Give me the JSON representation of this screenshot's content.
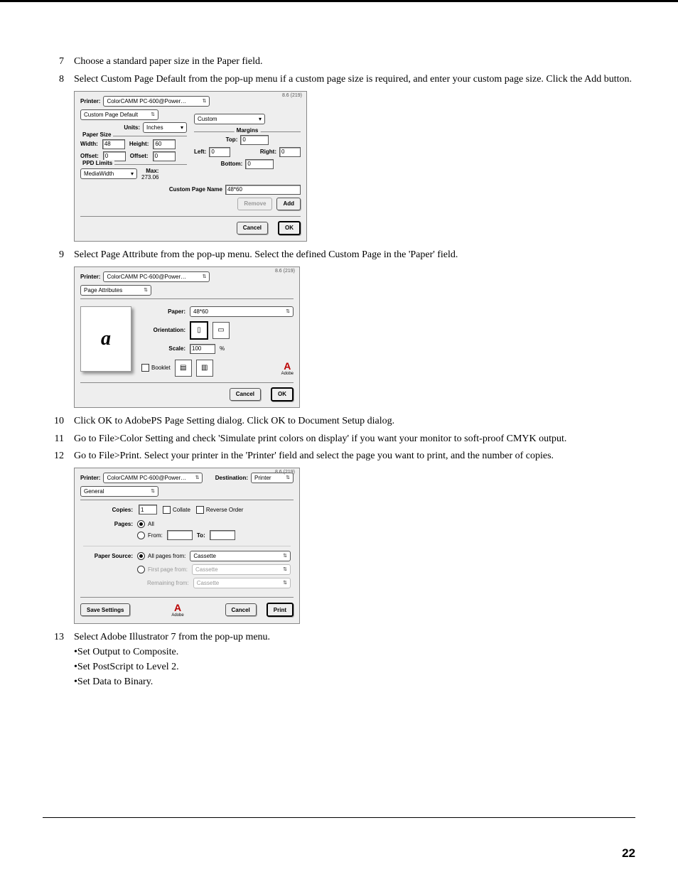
{
  "steps": {
    "s7": {
      "num": "7",
      "text": "Choose a standard paper size in the Paper field."
    },
    "s8": {
      "num": "8",
      "text": "Select Custom Page Default from the pop-up menu if a custom page size is required, and enter your custom page size. Click the Add button."
    },
    "s9": {
      "num": "9",
      "text": "Select Page Attribute from the pop-up menu. Select the defined Custom Page in the 'Paper' field."
    },
    "s10": {
      "num": "10",
      "text": "Click OK to AdobePS Page Setting dialog. Click OK to Document Setup dialog."
    },
    "s11": {
      "num": "11",
      "text": "Go to File>Color Setting and check 'Simulate print colors on display' if you want your monitor to soft-proof CMYK output."
    },
    "s12": {
      "num": "12",
      "text": "Go to File>Print. Select your printer in the 'Printer' field and select the page you want to print, and the number of copies."
    },
    "s13": {
      "num": "13",
      "text": "Select Adobe Illustrator 7 from the pop-up menu.",
      "b1": "•Set Output to Composite.",
      "b2": "•Set PostScript to Level 2.",
      "b3": "•Set Data to Binary."
    }
  },
  "d1": {
    "version": "8.6 (219)",
    "printer_lbl": "Printer:",
    "printer_val": "ColorCAMM PC-600@Power…",
    "tab": "Custom Page Default",
    "units_lbl": "Units:",
    "units_val": "Inches",
    "papersize_title": "Paper Size",
    "width_lbl": "Width:",
    "width_val": "48",
    "height_lbl": "Height:",
    "height_val": "60",
    "offset_lbl": "Offset:",
    "offset_val": "0",
    "offset2_lbl": "Offset:",
    "offset2_val": "0",
    "ppd_title": "PPD Limits",
    "ppd_sel": "MediaWidth",
    "max_lbl": "Max:",
    "max_val": "273.06",
    "custom_lbl": "Custom",
    "margins_title": "Margins",
    "top_lbl": "Top:",
    "top_val": "0",
    "left_lbl": "Left:",
    "left_val": "0",
    "right_lbl": "Right:",
    "right_val": "0",
    "bottom_lbl": "Bottom:",
    "bottom_val": "0",
    "pagename_lbl": "Custom Page Name",
    "pagename_val": "48*60",
    "remove": "Remove",
    "add": "Add",
    "cancel": "Cancel",
    "ok": "OK"
  },
  "d2": {
    "version": "8.6 (219)",
    "printer_lbl": "Printer:",
    "printer_val": "ColorCAMM PC-600@Power…",
    "tab": "Page Attributes",
    "paper_lbl": "Paper:",
    "paper_val": "48*60",
    "orient_lbl": "Orientation:",
    "scale_lbl": "Scale:",
    "scale_val": "100",
    "scale_pct": "%",
    "booklet": "Booklet",
    "preview_glyph": "a",
    "adobe": "Adobe",
    "cancel": "Cancel",
    "ok": "OK"
  },
  "d3": {
    "version": "8.6 (219)",
    "printer_lbl": "Printer:",
    "printer_val": "ColorCAMM PC-600@Power…",
    "dest_lbl": "Destination:",
    "dest_val": "Printer",
    "tab": "General",
    "copies_lbl": "Copies:",
    "copies_val": "1",
    "collate": "Collate",
    "revorder": "Reverse Order",
    "pages_lbl": "Pages:",
    "all": "All",
    "from_lbl": "From:",
    "to_lbl": "To:",
    "papersrc_lbl": "Paper Source:",
    "allpages": "All pages from:",
    "allpages_val": "Cassette",
    "firstpage": "First page from:",
    "firstpage_val": "Cassette",
    "remaining": "Remaining from:",
    "remaining_val": "Cassette",
    "save": "Save Settings",
    "adobe": "Adobe",
    "cancel": "Cancel",
    "print": "Print"
  },
  "page_number": "22"
}
